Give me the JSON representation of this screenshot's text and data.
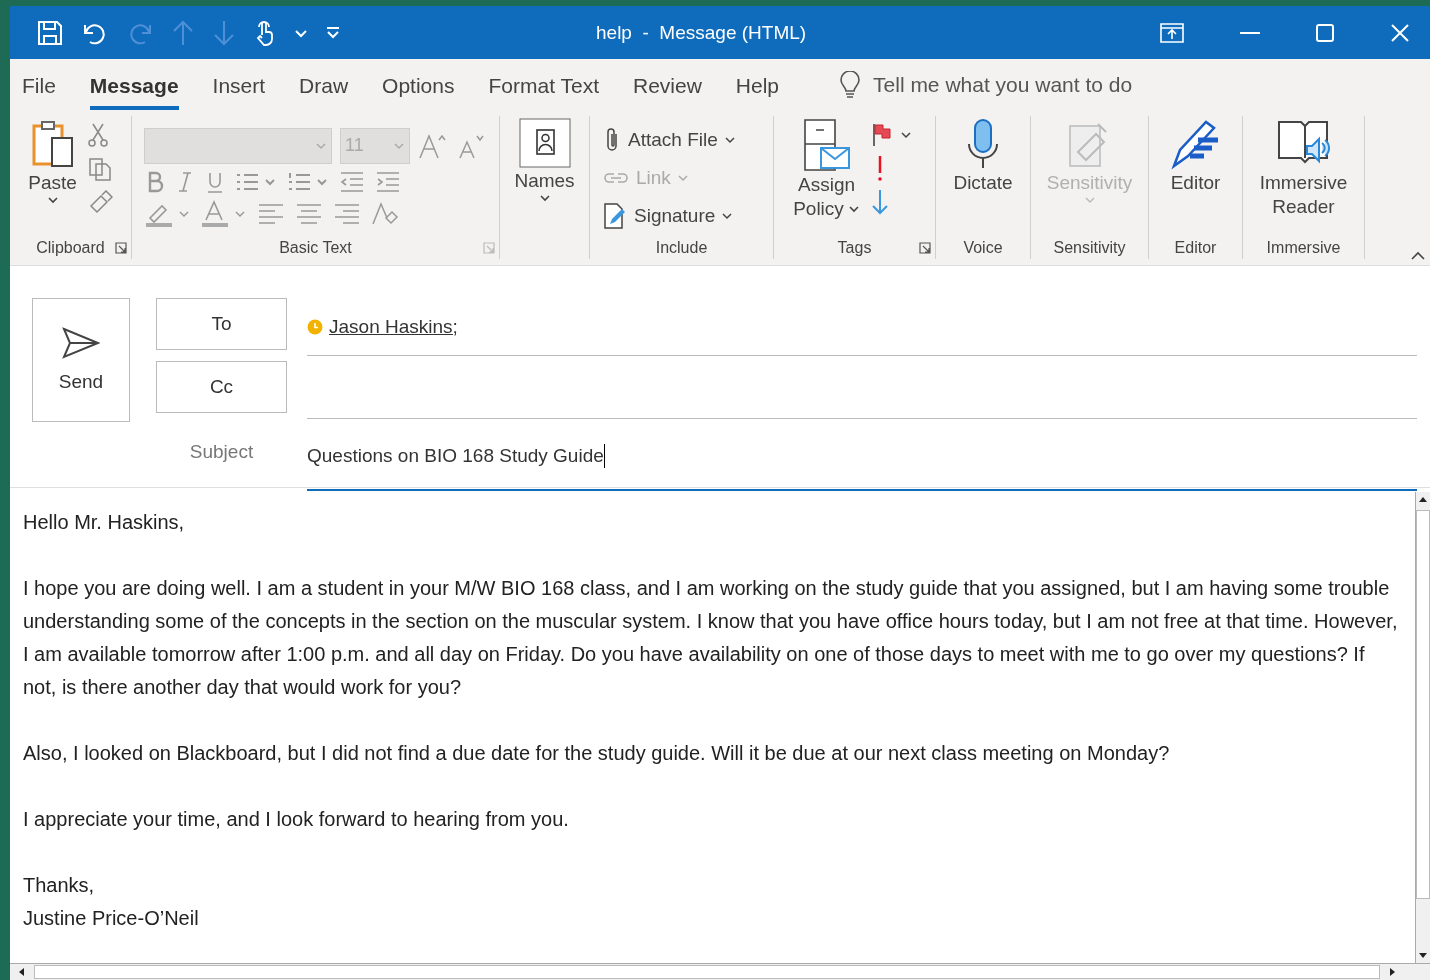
{
  "window": {
    "title": "help  -  Message (HTML)"
  },
  "tabs": [
    {
      "label": "File",
      "selected": false
    },
    {
      "label": "Message",
      "selected": true
    },
    {
      "label": "Insert",
      "selected": false
    },
    {
      "label": "Draw",
      "selected": false
    },
    {
      "label": "Options",
      "selected": false
    },
    {
      "label": "Format Text",
      "selected": false
    },
    {
      "label": "Review",
      "selected": false
    },
    {
      "label": "Help",
      "selected": false
    }
  ],
  "tell_me": {
    "placeholder": "Tell me what you want to do"
  },
  "ribbon": {
    "clipboard": {
      "label": "Clipboard",
      "paste": "Paste"
    },
    "basic_text": {
      "label": "Basic Text",
      "font_size": "11"
    },
    "names": {
      "button": "Names"
    },
    "include": {
      "label": "Include",
      "items": [
        {
          "label": "Attach File",
          "disabled": false
        },
        {
          "label": "Link",
          "disabled": true
        },
        {
          "label": "Signature",
          "disabled": false
        }
      ]
    },
    "tags": {
      "label": "Tags",
      "assign": [
        "Assign",
        "Policy"
      ]
    },
    "voice": {
      "label": "Voice",
      "button": "Dictate"
    },
    "sensitivity": {
      "label": "Sensitivity",
      "button": "Sensitivity",
      "disabled": true
    },
    "editor": {
      "label": "Editor",
      "button": "Editor"
    },
    "immersive": {
      "label": "Immersive",
      "button": [
        "Immersive",
        "Reader"
      ]
    }
  },
  "header": {
    "send": "Send",
    "to": "To",
    "cc": "Cc",
    "recipients": [
      "Jason Haskins;"
    ],
    "subject_label": "Subject",
    "subject": "Questions on BIO 168 Study Guide"
  },
  "body": [
    [
      "Hello Mr. Haskins,"
    ],
    [
      "I hope you are doing well. I am a student in your M/W BIO 168 class, and I am working on the study guide that you assigned, but I am having some trouble understanding some of the concepts in the section on the muscular system. I know that you have office hours today, but I am not free at that time. However, I am available tomorrow after 1:00 p.m. and all day on Friday. Do you have availability on one of those days to meet with me to go over my questions? If not, is there another day that would work for you?"
    ],
    [
      "Also, I looked on Blackboard, but I did not find a due date for the study guide. Will it be due at our next class meeting on Monday?"
    ],
    [
      "I appreciate your time, and I look forward to hearing from you."
    ],
    [
      "Thanks,",
      "Justine Price-O’Neil"
    ]
  ]
}
